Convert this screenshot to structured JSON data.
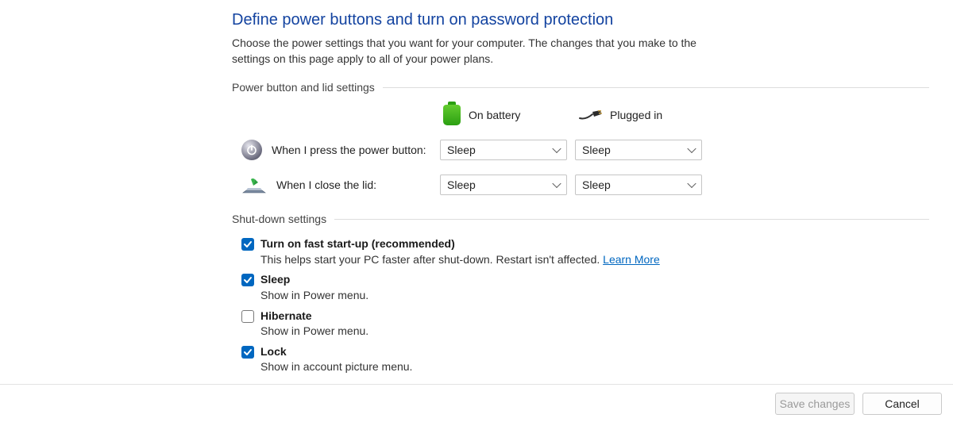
{
  "page": {
    "title": "Define power buttons and turn on password protection",
    "intro": "Choose the power settings that you want for your computer. The changes that you make to the settings on this page apply to all of your power plans."
  },
  "sections": {
    "power_button_lid": {
      "header": "Power button and lid settings",
      "columns": {
        "on_battery": "On battery",
        "plugged_in": "Plugged in"
      },
      "rows": {
        "power_button": {
          "label": "When I press the power button:",
          "on_battery": "Sleep",
          "plugged_in": "Sleep"
        },
        "close_lid": {
          "label": "When I close the lid:",
          "on_battery": "Sleep",
          "plugged_in": "Sleep"
        }
      }
    },
    "shutdown": {
      "header": "Shut-down settings",
      "items": [
        {
          "key": "fast_startup",
          "checked": true,
          "title": "Turn on fast start-up (recommended)",
          "desc_prefix": "This helps start your PC faster after shut-down. Restart isn't affected. ",
          "learn_more": "Learn More"
        },
        {
          "key": "sleep",
          "checked": true,
          "title": "Sleep",
          "desc": "Show in Power menu."
        },
        {
          "key": "hibernate",
          "checked": false,
          "title": "Hibernate",
          "desc": "Show in Power menu."
        },
        {
          "key": "lock",
          "checked": true,
          "title": "Lock",
          "desc": "Show in account picture menu."
        }
      ]
    }
  },
  "footer": {
    "save": "Save changes",
    "cancel": "Cancel"
  }
}
